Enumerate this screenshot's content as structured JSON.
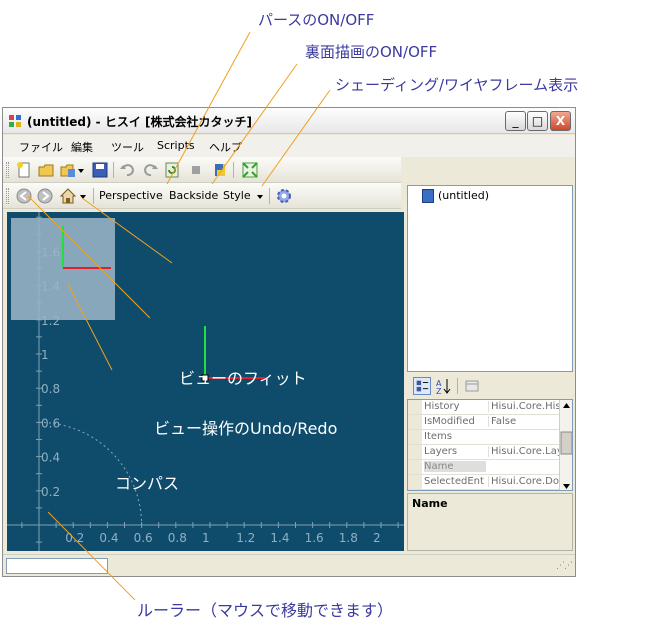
{
  "annotations": {
    "perspective_toggle": "パースのON/OFF",
    "backside_toggle": "裏面描画のON/OFF",
    "shading_toggle": "シェーディング/ワイヤフレーム表示",
    "view_fit": "ビューのフィット",
    "view_undo_redo": "ビュー操作のUndo/Redo",
    "compass": "コンパス",
    "ruler": "ルーラー（マウスで移動できます）"
  },
  "window": {
    "title": "(untitled) - ヒスイ [株式会社カタッチ]",
    "minimize": "_",
    "maximize": "□",
    "close": "X"
  },
  "menu": [
    "ファイル",
    "編集",
    "ツール",
    "Scripts",
    "ヘルプ"
  ],
  "view_toolbar": {
    "perspective": "Perspective",
    "backside": "Backside",
    "style": "Style"
  },
  "tree": {
    "root": "(untitled)"
  },
  "properties": [
    {
      "name": "History",
      "value": "Hisui.Core.His"
    },
    {
      "name": "IsModified",
      "value": "False"
    },
    {
      "name": "Items",
      "value": ""
    },
    {
      "name": "Layers",
      "value": "Hisui.Core.Lay"
    },
    {
      "name": "Name",
      "value": ""
    },
    {
      "name": "SelectedEnt",
      "value": "Hisui.Core.Do"
    }
  ],
  "description": {
    "title": "Name"
  },
  "ruler": {
    "x_ticks": [
      "0.2",
      "0.4",
      "0.6",
      "0.8",
      "1",
      "1.2",
      "1.4",
      "1.6",
      "1.8",
      "2"
    ],
    "y_ticks": [
      "0.2",
      "0.4",
      "0.6",
      "0.8",
      "1",
      "1.2",
      "1.4",
      "1.6"
    ]
  },
  "colors": {
    "viewport_bg": "#0f4c6c",
    "axis_x": "#e0202a",
    "axis_y": "#20e040",
    "callout_line": "#f0a020",
    "callout_text": "#3a3aa0"
  }
}
